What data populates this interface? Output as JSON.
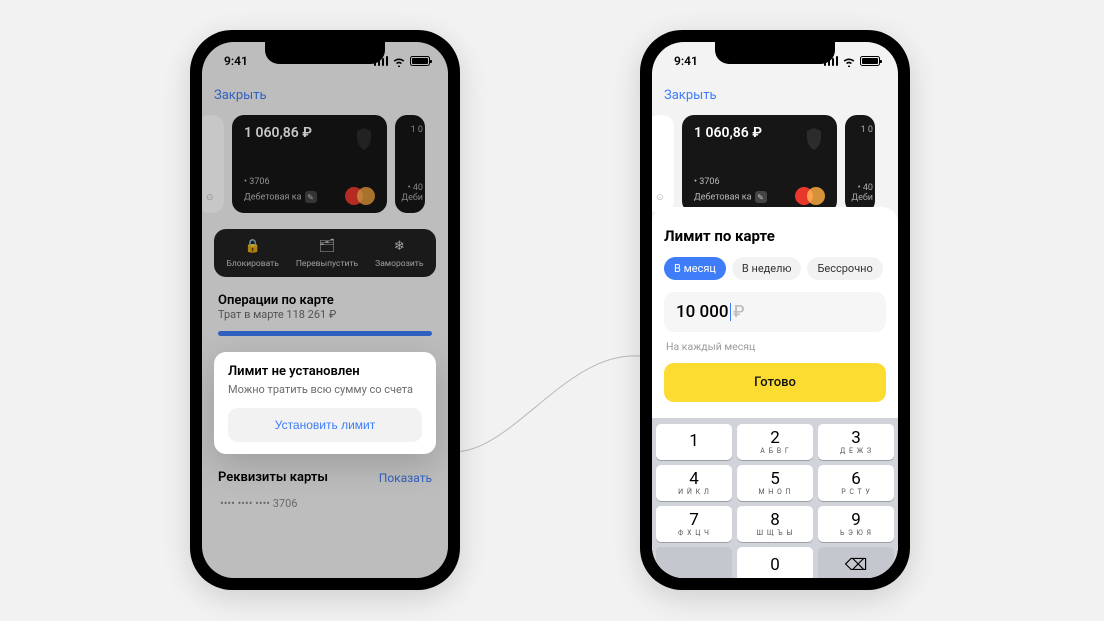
{
  "status": {
    "time": "9:41"
  },
  "header": {
    "close": "Закрыть"
  },
  "card": {
    "balance": "1 060,86 ₽",
    "number": "• 3706",
    "type": "Дебетовая ка",
    "peek_balance": "1 0",
    "peek_number": "• 40",
    "peek_type": "Деби"
  },
  "actions": {
    "block": "Блокировать",
    "reissue": "Перевыпустить",
    "freeze": "Заморозить"
  },
  "operations": {
    "title": "Операции по карте",
    "subtitle": "Трат в марте 118 261 ₽"
  },
  "limit": {
    "title": "Лимит не установлен",
    "subtitle": "Можно тратить всю сумму со счета",
    "button": "Установить лимит"
  },
  "requisites": {
    "title": "Реквизиты карты",
    "show": "Показать",
    "masked": "•••• •••• •••• 3706"
  },
  "sheet": {
    "title": "Лимит по карте",
    "tab_month": "В месяц",
    "tab_week": "В неделю",
    "tab_forever": "Бессрочно",
    "amount": "10 000",
    "currency": "₽",
    "hint": "На каждый месяц",
    "done": "Готово"
  },
  "keys": [
    {
      "n": "1",
      "s": ""
    },
    {
      "n": "2",
      "s": "А Б В Г"
    },
    {
      "n": "3",
      "s": "Д Е Ж З"
    },
    {
      "n": "4",
      "s": "И Й К Л"
    },
    {
      "n": "5",
      "s": "М Н О П"
    },
    {
      "n": "6",
      "s": "Р С Т У"
    },
    {
      "n": "7",
      "s": "Ф Х Ц Ч"
    },
    {
      "n": "8",
      "s": "Ш Щ Ъ Ы"
    },
    {
      "n": "9",
      "s": "Ь Э Ю Я"
    },
    {
      "n": "0",
      "s": ""
    }
  ]
}
